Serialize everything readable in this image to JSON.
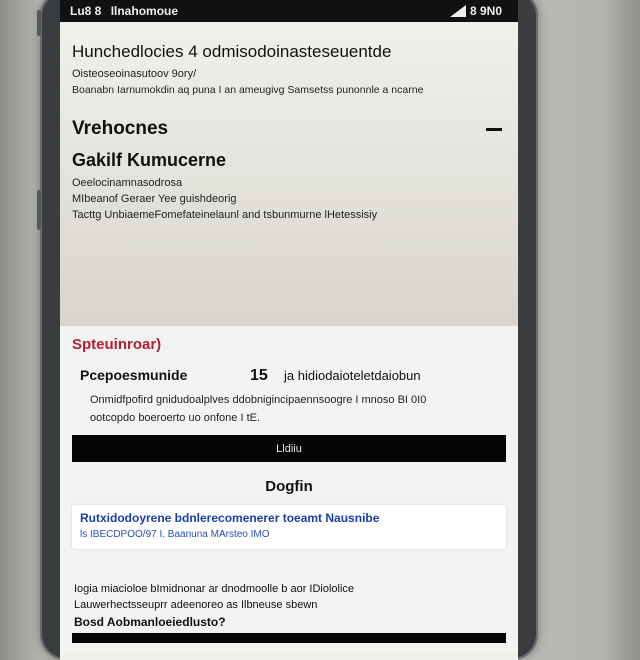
{
  "status_bar": {
    "left_text": "Lu8 8",
    "left_text2": "Ilnahomoue",
    "right_text": "8 9N0"
  },
  "header": {
    "title": "Hunchedlocies 4 odmisodoinasteseuentde",
    "subtitle": "Oisteoseoinasutoov 9ory/",
    "line": "Boanabn Iarnumokdin aq puna I an ameugivg Samsetss punonnle a ncarne"
  },
  "group": {
    "title": "Vrehocnes",
    "collapse_label": "−"
  },
  "device": {
    "name": "Gakilf Kumucerne",
    "line1": "Oeelocinamnasodrosa",
    "line2": "MIbeanof Geraer Yee guishdeorig",
    "line3": "Tacttg UnbiaemeFomefateinelaunl and tsbunmurne lHetessisiy"
  },
  "settings": {
    "section_title": "Spteuinroar)",
    "param_label": "Pcepoesmunide",
    "param_value": "15",
    "param_unit": "ja hidiodaioteletdaiobun",
    "param_desc_line1": "Onmidfpofird gnidudoalplves ddobnigincipaennsoogre I mnoso BI 0I0",
    "param_desc_line2": "ootcopdo boeroerto uo onfone I tE.",
    "action_button": "Lldiiu"
  },
  "section2": {
    "title": "Dogfin",
    "link_main": "Rutxidodoyrene bdnlerecomenerer toeamt Nausnibe",
    "link_sub": "ls IBECDPOO/97 I. Baanuna MArsteo IMO"
  },
  "footer": {
    "line1": "Iogia miacioloe bImidnonar ar dnodmoolle b aor IDiololice",
    "line2": "Lauwerhectsseuprr adeenoreo as Ilbneuse sbewn",
    "bold_line": "Bosd Aobmanloeiedlusto?"
  },
  "colors": {
    "accent_red": "#b41f33",
    "link_blue": "#1a3fa8",
    "button_black": "#050505"
  }
}
